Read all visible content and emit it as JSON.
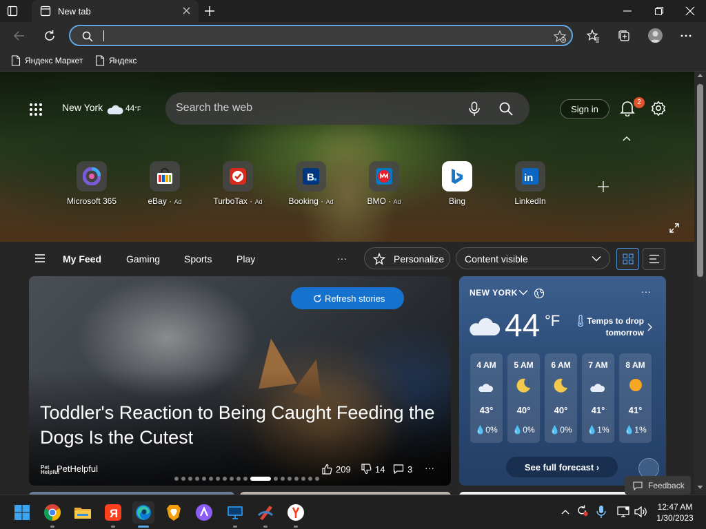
{
  "browser": {
    "tab_title": "New tab",
    "address_value": "",
    "bookmarks": [
      {
        "label": "Яндекс Маркет",
        "icon": "page-icon"
      },
      {
        "label": "Яндекс",
        "icon": "page-icon"
      }
    ]
  },
  "newtab": {
    "location": "New York",
    "location_temp": "44",
    "location_unit": "°F",
    "search_placeholder": "Search the web",
    "sign_in": "Sign in",
    "notification_count": "2",
    "quick_links": [
      {
        "label": "Microsoft 365",
        "ad": "",
        "icon": "microsoft-365-icon",
        "color": "#7b5cd6"
      },
      {
        "label": "eBay",
        "ad": "Ad",
        "icon": "ebay-icon",
        "color": "#e53238"
      },
      {
        "label": "TurboTax",
        "ad": "Ad",
        "icon": "turbotax-icon",
        "color": "#d52b1e"
      },
      {
        "label": "Booking",
        "ad": "Ad",
        "icon": "booking-icon",
        "color": "#003580"
      },
      {
        "label": "BMO",
        "ad": "Ad",
        "icon": "bmo-icon",
        "color": "#e3202b"
      },
      {
        "label": "Bing",
        "ad": "",
        "icon": "bing-icon",
        "color": "#1a78c8"
      },
      {
        "label": "LinkedIn",
        "ad": "",
        "icon": "linkedin-icon",
        "color": "#0a66c2"
      }
    ]
  },
  "feed": {
    "tabs": [
      "My Feed",
      "Gaming",
      "Sports",
      "Play"
    ],
    "more": "···",
    "personalize": "Personalize",
    "content_visibility": "Content visible"
  },
  "story": {
    "refresh_label": "Refresh stories",
    "headline": "Toddler's Reaction to Being Caught Feeding the Dogs Is the Cutest",
    "publisher": "PetHelpful",
    "publisher_logo_text": "Pet\nHelpful",
    "likes": "209",
    "dislikes": "14",
    "comments": "3",
    "more": "···",
    "carousel_total": 19,
    "carousel_active": 11
  },
  "weather": {
    "location": "NEW YORK",
    "more": "···",
    "temp": "44",
    "unit": "°F",
    "alert": "Temps to drop tomorrow",
    "hourly": [
      {
        "time": "4 AM",
        "icon": "partly-cloudy-night-icon",
        "temp": "43°",
        "precip": "0%"
      },
      {
        "time": "5 AM",
        "icon": "moon-icon",
        "temp": "40°",
        "precip": "0%"
      },
      {
        "time": "6 AM",
        "icon": "moon-icon",
        "temp": "40°",
        "precip": "0%"
      },
      {
        "time": "7 AM",
        "icon": "partly-cloudy-night-icon",
        "temp": "41°",
        "precip": "1%"
      },
      {
        "time": "8 AM",
        "icon": "sun-icon",
        "temp": "41°",
        "precip": "1%"
      }
    ],
    "full_forecast": "See full forecast ›"
  },
  "feedback": "Feedback",
  "taskbar": {
    "apps": [
      "start-icon",
      "chrome-icon",
      "file-explorer-icon",
      "yandex-browser-icon",
      "edge-icon",
      "brave-icon",
      "alice-icon",
      "remote-desktop-icon",
      "ccleaner-icon",
      "yandex-icon"
    ],
    "time": "12:47 AM",
    "date": "1/30/2023"
  },
  "colors": {
    "accent": "#1573cf",
    "omnibox_focus": "#5fa7e3",
    "badge": "#e0532d"
  }
}
